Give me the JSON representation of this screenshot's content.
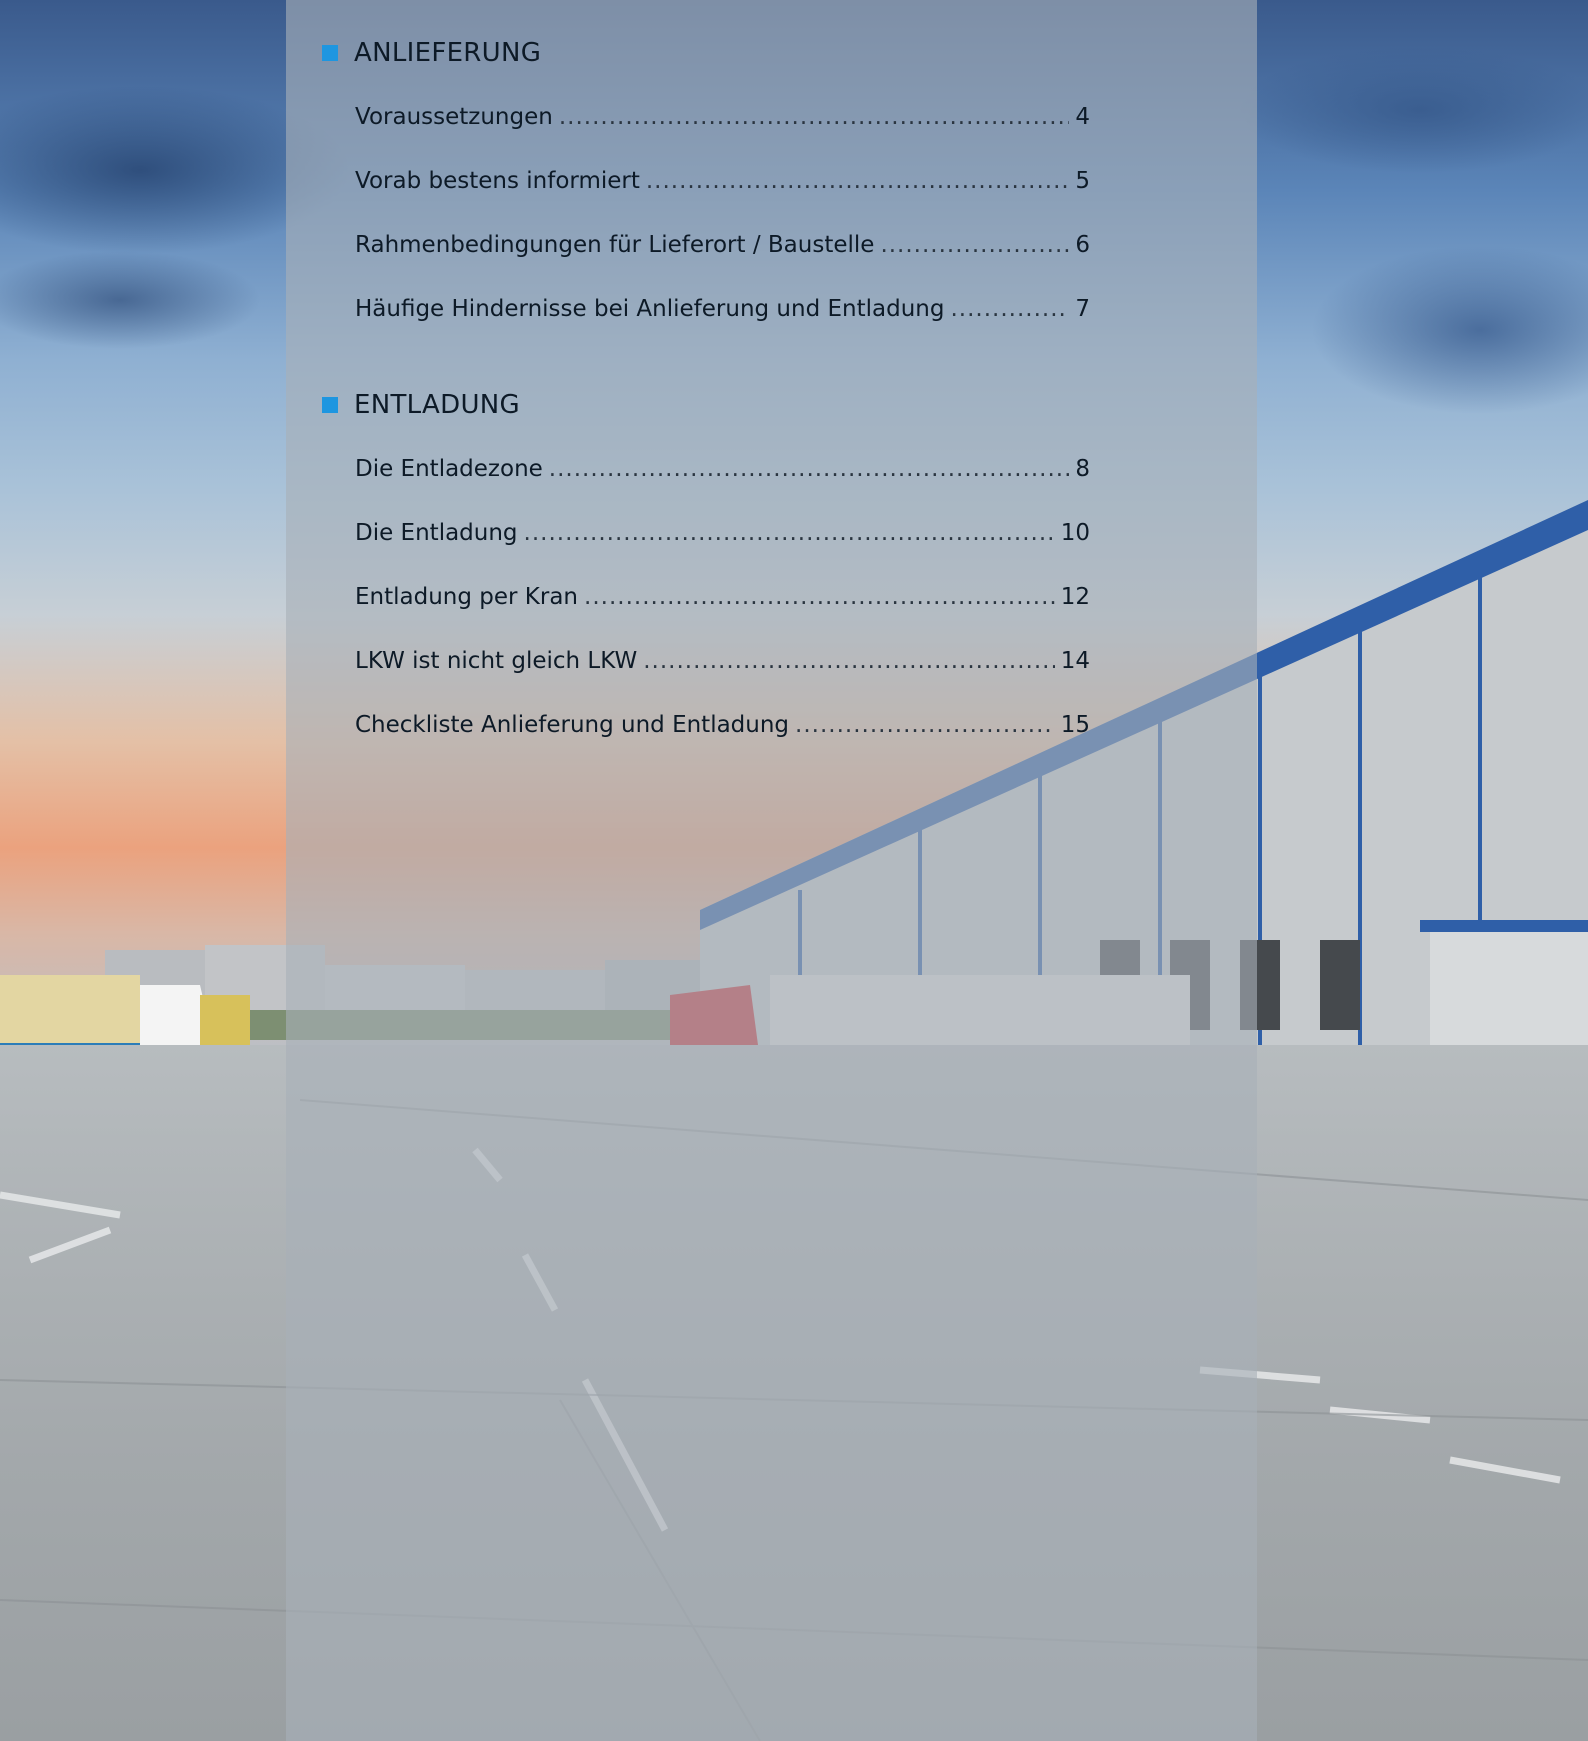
{
  "toc": {
    "sections": [
      {
        "heading": "ANLIEFERUNG",
        "entries": [
          {
            "title": "Voraussetzungen",
            "page": "4"
          },
          {
            "title": "Vorab bestens informiert",
            "page": "5"
          },
          {
            "title": "Rahmenbedingungen für Lieferort / Baustelle",
            "page": "6"
          },
          {
            "title": "Häufige Hindernisse bei Anlieferung und Entladung",
            "page": "7"
          }
        ]
      },
      {
        "heading": "ENTLADUNG",
        "entries": [
          {
            "title": "Die Entladezone",
            "page": "8"
          },
          {
            "title": "Die Entladung",
            "page": "10"
          },
          {
            "title": "Entladung per Kran",
            "page": "12"
          },
          {
            "title": "LKW ist nicht gleich LKW",
            "page": "14"
          },
          {
            "title": "Checkliste Anlieferung und Entladung",
            "page": "15"
          }
        ]
      }
    ]
  },
  "colors": {
    "marker": "#1e96e0",
    "text": "#0d1a27",
    "panel": "rgba(168,176,184,0.62)"
  },
  "background": {
    "icon": "warehouse-loading-yard-photo"
  }
}
